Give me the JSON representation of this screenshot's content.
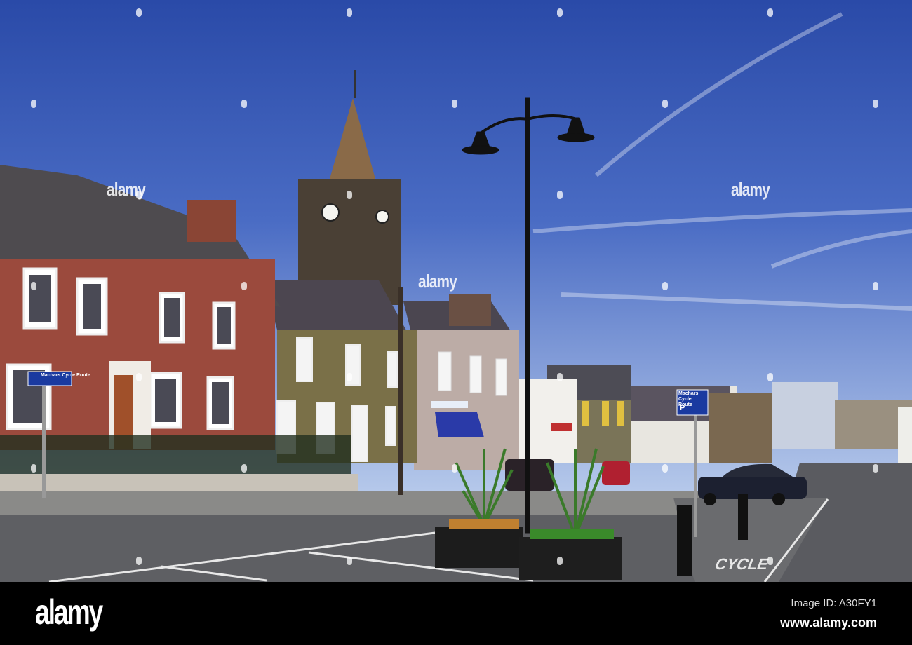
{
  "watermark": {
    "text": "alamy"
  },
  "footer": {
    "logo": "alamy",
    "image_id": "Image ID: A30FY1",
    "website": "www.alamy.com"
  },
  "signs": {
    "cycle_route_left": "Machars Cycle Route",
    "cycle_route_right": "Machars Cycle Route",
    "parking": "P",
    "road_marking": "CYCLE"
  },
  "colors": {
    "sky_top": "#2a4aa8",
    "sky_bottom": "#b5c8ea",
    "red_house": "#9b4a3d",
    "awning": "#2a3aa8"
  }
}
